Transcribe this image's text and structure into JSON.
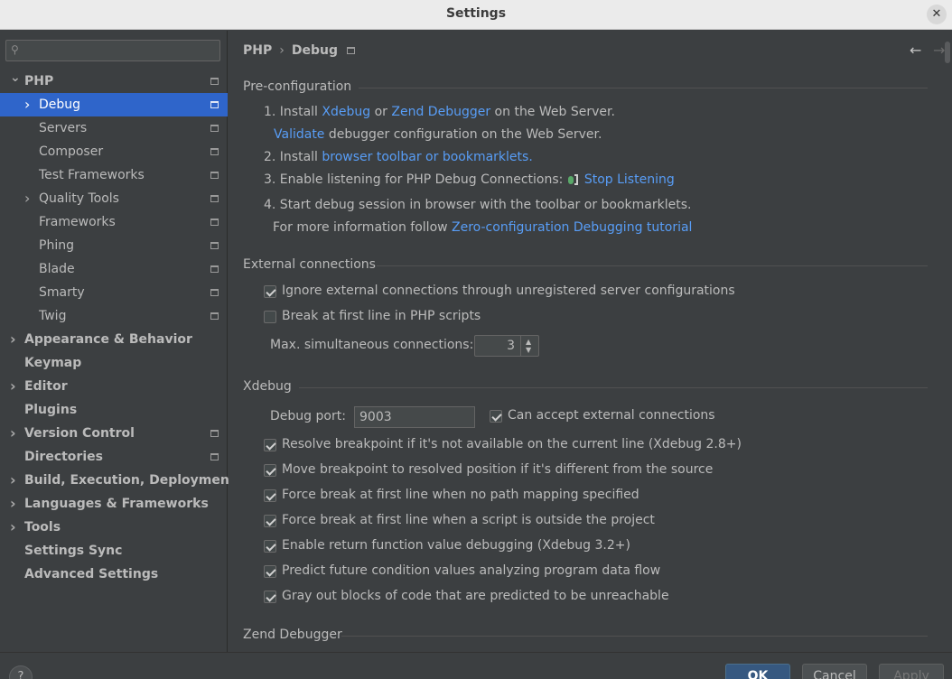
{
  "window": {
    "title": "Settings",
    "close_glyph": "✕"
  },
  "search": {
    "placeholder": "",
    "icon": "search-icon"
  },
  "tree": [
    {
      "label": "PHP",
      "bold": true,
      "expanded": true,
      "indent": 0,
      "proj": true
    },
    {
      "label": "Debug",
      "bold": false,
      "selected": true,
      "indent": 1,
      "arrow": true,
      "proj": true
    },
    {
      "label": "Servers",
      "indent": 1,
      "proj": true
    },
    {
      "label": "Composer",
      "indent": 1,
      "proj": true
    },
    {
      "label": "Test Frameworks",
      "indent": 1,
      "proj": true
    },
    {
      "label": "Quality Tools",
      "indent": 1,
      "arrow": true,
      "proj": true
    },
    {
      "label": "Frameworks",
      "indent": 1,
      "proj": true
    },
    {
      "label": "Phing",
      "indent": 1,
      "proj": true
    },
    {
      "label": "Blade",
      "indent": 1,
      "proj": true
    },
    {
      "label": "Smarty",
      "indent": 1,
      "proj": true
    },
    {
      "label": "Twig",
      "indent": 1,
      "proj": true
    },
    {
      "label": "Appearance & Behavior",
      "bold": true,
      "arrow": true,
      "indent": 0
    },
    {
      "label": "Keymap",
      "bold": true,
      "indent": 0
    },
    {
      "label": "Editor",
      "bold": true,
      "arrow": true,
      "indent": 0
    },
    {
      "label": "Plugins",
      "bold": true,
      "indent": 0
    },
    {
      "label": "Version Control",
      "bold": true,
      "arrow": true,
      "indent": 0,
      "proj": true
    },
    {
      "label": "Directories",
      "bold": true,
      "indent": 0,
      "proj": true
    },
    {
      "label": "Build, Execution, Deployment",
      "bold": true,
      "arrow": true,
      "indent": 0
    },
    {
      "label": "Languages & Frameworks",
      "bold": true,
      "arrow": true,
      "indent": 0
    },
    {
      "label": "Tools",
      "bold": true,
      "arrow": true,
      "indent": 0
    },
    {
      "label": "Settings Sync",
      "bold": true,
      "indent": 0
    },
    {
      "label": "Advanced Settings",
      "bold": true,
      "indent": 0
    }
  ],
  "breadcrumb": {
    "part1": "PHP",
    "sep": "›",
    "part2": "Debug"
  },
  "nav": {
    "back": "←",
    "forward": "→"
  },
  "preconfig": {
    "title": "Pre-configuration",
    "step1_prefix": "1. Install ",
    "xdebug_link": "Xdebug",
    "or": " or ",
    "zend_link": "Zend Debugger",
    "step1_suffix": " on the Web Server.",
    "validate_link": "Validate",
    "validate_suffix": " debugger configuration on the Web Server.",
    "step2_prefix": "2. Install ",
    "toolbar_link": "browser toolbar or bookmarklets.",
    "step3_prefix": "3. Enable listening for PHP Debug Connections: ",
    "stop_link": "Stop Listening",
    "step4": "4. Start debug session in browser with the toolbar or bookmarklets.",
    "more_prefix": "For more information follow ",
    "tutorial_link": "Zero-configuration Debugging tutorial"
  },
  "external": {
    "title": "External connections",
    "ignore_label": "Ignore external connections through unregistered server configurations",
    "ignore_checked": true,
    "break_label": "Break at first line in PHP scripts",
    "break_checked": false,
    "max_label": "Max. simultaneous connections:",
    "max_value": "3"
  },
  "xdebug": {
    "title": "Xdebug",
    "port_label": "Debug port:",
    "port_value": "9003",
    "accept_label": "Can accept external connections",
    "options": [
      "Resolve breakpoint if it's not available on the current line (Xdebug 2.8+)",
      "Move breakpoint to resolved position if it's different from the source",
      "Force break at first line when no path mapping specified",
      "Force break at first line when a script is outside the project",
      "Enable return function value debugging (Xdebug 3.2+)",
      "Predict future condition values analyzing program data flow",
      "Gray out blocks of code that are predicted to be unreachable"
    ]
  },
  "zend": {
    "title": "Zend Debugger"
  },
  "footer": {
    "help": "?",
    "ok": "OK",
    "cancel": "Cancel",
    "apply": "Apply"
  }
}
